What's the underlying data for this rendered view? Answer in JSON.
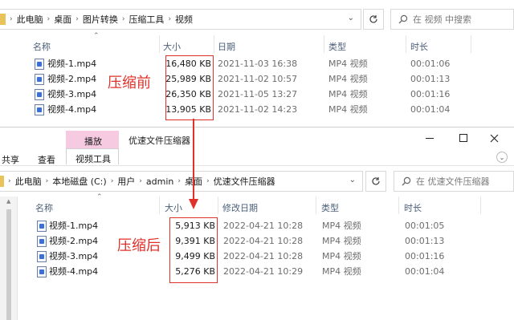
{
  "top_window": {
    "breadcrumb": [
      "此电脑",
      "桌面",
      "图片转换",
      "压缩工具",
      "视频"
    ],
    "search_placeholder": "在 视频 中搜索",
    "columns": {
      "name": "名称",
      "size": "大小",
      "date": "日期",
      "type": "类型",
      "duration": "时长"
    },
    "files": [
      {
        "name": "视频-1.mp4",
        "size": "16,480 KB",
        "date": "2021-11-03 16:38",
        "type": "MP4 视频",
        "duration": "00:01:06"
      },
      {
        "name": "视频-2.mp4",
        "size": "25,989 KB",
        "date": "2021-11-02 10:57",
        "type": "MP4 视频",
        "duration": "00:01:13"
      },
      {
        "name": "视频-3.mp4",
        "size": "26,350 KB",
        "date": "2021-11-05 13:27",
        "type": "MP4 视频",
        "duration": "00:01:16"
      },
      {
        "name": "视频-4.mp4",
        "size": "13,905 KB",
        "date": "2021-11-02 14:23",
        "type": "MP4 视频",
        "duration": "00:01:04"
      }
    ],
    "annotation": "压缩前"
  },
  "bottom_window": {
    "ribbon": {
      "context_tab": "播放",
      "context_group": "视频工具",
      "share": "共享",
      "view": "查看",
      "title": "优速文件压缩器"
    },
    "controls": {
      "minimize": "—",
      "maximize": "☐",
      "close": "✕"
    },
    "breadcrumb": [
      "此电脑",
      "本地磁盘 (C:)",
      "用户",
      "admin",
      "桌面",
      "优速文件压缩器"
    ],
    "search_placeholder": "在 优速文件压缩器",
    "columns": {
      "name": "名称",
      "size": "大小",
      "date": "修改日期",
      "type": "类型",
      "duration": "时长"
    },
    "files": [
      {
        "name": "视频-1.mp4",
        "size": "5,913 KB",
        "date": "2022-04-21 10:28",
        "type": "MP4 视频",
        "duration": "00:01:05"
      },
      {
        "name": "视频-2.mp4",
        "size": "9,391 KB",
        "date": "2022-04-21 10:28",
        "type": "MP4 视频",
        "duration": "00:01:13"
      },
      {
        "name": "视频-3.mp4",
        "size": "9,499 KB",
        "date": "2022-04-21 10:28",
        "type": "MP4 视频",
        "duration": "00:01:16"
      },
      {
        "name": "视频-4.mp4",
        "size": "5,276 KB",
        "date": "2022-04-21 10:29",
        "type": "MP4 视频",
        "duration": "00:01:04"
      }
    ],
    "annotation": "压缩后"
  },
  "colors": {
    "annotation_red": "#e0302a",
    "context_tab_pink": "#f6cbe2",
    "header_text": "#4c607a"
  }
}
